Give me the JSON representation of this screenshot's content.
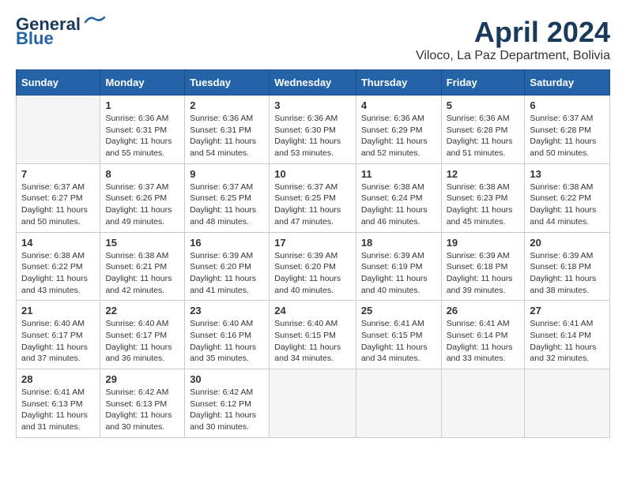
{
  "header": {
    "logo_line1": "General",
    "logo_line2": "Blue",
    "month": "April 2024",
    "location": "Viloco, La Paz Department, Bolivia"
  },
  "weekdays": [
    "Sunday",
    "Monday",
    "Tuesday",
    "Wednesday",
    "Thursday",
    "Friday",
    "Saturday"
  ],
  "weeks": [
    [
      {
        "day": "",
        "info": ""
      },
      {
        "day": "1",
        "info": "Sunrise: 6:36 AM\nSunset: 6:31 PM\nDaylight: 11 hours\nand 55 minutes."
      },
      {
        "day": "2",
        "info": "Sunrise: 6:36 AM\nSunset: 6:31 PM\nDaylight: 11 hours\nand 54 minutes."
      },
      {
        "day": "3",
        "info": "Sunrise: 6:36 AM\nSunset: 6:30 PM\nDaylight: 11 hours\nand 53 minutes."
      },
      {
        "day": "4",
        "info": "Sunrise: 6:36 AM\nSunset: 6:29 PM\nDaylight: 11 hours\nand 52 minutes."
      },
      {
        "day": "5",
        "info": "Sunrise: 6:36 AM\nSunset: 6:28 PM\nDaylight: 11 hours\nand 51 minutes."
      },
      {
        "day": "6",
        "info": "Sunrise: 6:37 AM\nSunset: 6:28 PM\nDaylight: 11 hours\nand 50 minutes."
      }
    ],
    [
      {
        "day": "7",
        "info": "Sunrise: 6:37 AM\nSunset: 6:27 PM\nDaylight: 11 hours\nand 50 minutes."
      },
      {
        "day": "8",
        "info": "Sunrise: 6:37 AM\nSunset: 6:26 PM\nDaylight: 11 hours\nand 49 minutes."
      },
      {
        "day": "9",
        "info": "Sunrise: 6:37 AM\nSunset: 6:25 PM\nDaylight: 11 hours\nand 48 minutes."
      },
      {
        "day": "10",
        "info": "Sunrise: 6:37 AM\nSunset: 6:25 PM\nDaylight: 11 hours\nand 47 minutes."
      },
      {
        "day": "11",
        "info": "Sunrise: 6:38 AM\nSunset: 6:24 PM\nDaylight: 11 hours\nand 46 minutes."
      },
      {
        "day": "12",
        "info": "Sunrise: 6:38 AM\nSunset: 6:23 PM\nDaylight: 11 hours\nand 45 minutes."
      },
      {
        "day": "13",
        "info": "Sunrise: 6:38 AM\nSunset: 6:22 PM\nDaylight: 11 hours\nand 44 minutes."
      }
    ],
    [
      {
        "day": "14",
        "info": "Sunrise: 6:38 AM\nSunset: 6:22 PM\nDaylight: 11 hours\nand 43 minutes."
      },
      {
        "day": "15",
        "info": "Sunrise: 6:38 AM\nSunset: 6:21 PM\nDaylight: 11 hours\nand 42 minutes."
      },
      {
        "day": "16",
        "info": "Sunrise: 6:39 AM\nSunset: 6:20 PM\nDaylight: 11 hours\nand 41 minutes."
      },
      {
        "day": "17",
        "info": "Sunrise: 6:39 AM\nSunset: 6:20 PM\nDaylight: 11 hours\nand 40 minutes."
      },
      {
        "day": "18",
        "info": "Sunrise: 6:39 AM\nSunset: 6:19 PM\nDaylight: 11 hours\nand 40 minutes."
      },
      {
        "day": "19",
        "info": "Sunrise: 6:39 AM\nSunset: 6:18 PM\nDaylight: 11 hours\nand 39 minutes."
      },
      {
        "day": "20",
        "info": "Sunrise: 6:39 AM\nSunset: 6:18 PM\nDaylight: 11 hours\nand 38 minutes."
      }
    ],
    [
      {
        "day": "21",
        "info": "Sunrise: 6:40 AM\nSunset: 6:17 PM\nDaylight: 11 hours\nand 37 minutes."
      },
      {
        "day": "22",
        "info": "Sunrise: 6:40 AM\nSunset: 6:17 PM\nDaylight: 11 hours\nand 36 minutes."
      },
      {
        "day": "23",
        "info": "Sunrise: 6:40 AM\nSunset: 6:16 PM\nDaylight: 11 hours\nand 35 minutes."
      },
      {
        "day": "24",
        "info": "Sunrise: 6:40 AM\nSunset: 6:15 PM\nDaylight: 11 hours\nand 34 minutes."
      },
      {
        "day": "25",
        "info": "Sunrise: 6:41 AM\nSunset: 6:15 PM\nDaylight: 11 hours\nand 34 minutes."
      },
      {
        "day": "26",
        "info": "Sunrise: 6:41 AM\nSunset: 6:14 PM\nDaylight: 11 hours\nand 33 minutes."
      },
      {
        "day": "27",
        "info": "Sunrise: 6:41 AM\nSunset: 6:14 PM\nDaylight: 11 hours\nand 32 minutes."
      }
    ],
    [
      {
        "day": "28",
        "info": "Sunrise: 6:41 AM\nSunset: 6:13 PM\nDaylight: 11 hours\nand 31 minutes."
      },
      {
        "day": "29",
        "info": "Sunrise: 6:42 AM\nSunset: 6:13 PM\nDaylight: 11 hours\nand 30 minutes."
      },
      {
        "day": "30",
        "info": "Sunrise: 6:42 AM\nSunset: 6:12 PM\nDaylight: 11 hours\nand 30 minutes."
      },
      {
        "day": "",
        "info": ""
      },
      {
        "day": "",
        "info": ""
      },
      {
        "day": "",
        "info": ""
      },
      {
        "day": "",
        "info": ""
      }
    ]
  ]
}
